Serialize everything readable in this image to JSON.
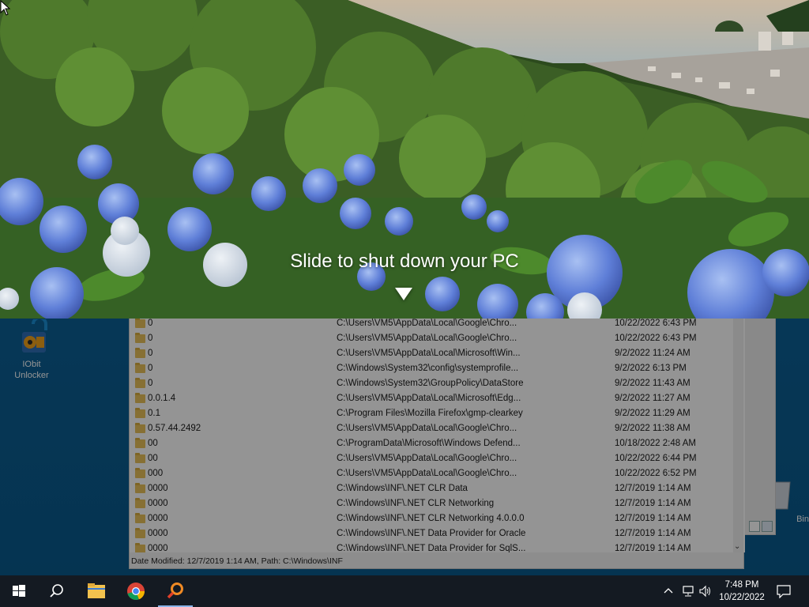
{
  "desktop": {
    "icons": [
      {
        "label_line1": "IObit",
        "label_line2": "Unlocker"
      },
      {
        "label": "Bin"
      }
    ]
  },
  "shutdown": {
    "message": "Slide to shut down your PC"
  },
  "results": {
    "rows": [
      {
        "name": "0",
        "path": "C:\\Users\\VM5\\AppData\\Local\\Google\\Chro...",
        "date": "10/22/2022 6:43 PM"
      },
      {
        "name": "0",
        "path": "C:\\Users\\VM5\\AppData\\Local\\Google\\Chro...",
        "date": "10/22/2022 6:43 PM"
      },
      {
        "name": "0",
        "path": "C:\\Users\\VM5\\AppData\\Local\\Microsoft\\Win...",
        "date": "9/2/2022 11:24 AM"
      },
      {
        "name": "0",
        "path": "C:\\Windows\\System32\\config\\systemprofile...",
        "date": "9/2/2022 6:13 PM"
      },
      {
        "name": "0",
        "path": "C:\\Windows\\System32\\GroupPolicy\\DataStore",
        "date": "9/2/2022 11:43 AM"
      },
      {
        "name": "0.0.1.4",
        "path": "C:\\Users\\VM5\\AppData\\Local\\Microsoft\\Edg...",
        "date": "9/2/2022 11:27 AM"
      },
      {
        "name": "0.1",
        "path": "C:\\Program Files\\Mozilla Firefox\\gmp-clearkey",
        "date": "9/2/2022 11:29 AM"
      },
      {
        "name": "0.57.44.2492",
        "path": "C:\\Users\\VM5\\AppData\\Local\\Google\\Chro...",
        "date": "9/2/2022 11:38 AM"
      },
      {
        "name": "00",
        "path": "C:\\ProgramData\\Microsoft\\Windows Defend...",
        "date": "10/18/2022 2:48 AM"
      },
      {
        "name": "00",
        "path": "C:\\Users\\VM5\\AppData\\Local\\Google\\Chro...",
        "date": "10/22/2022 6:44 PM"
      },
      {
        "name": "000",
        "path": "C:\\Users\\VM5\\AppData\\Local\\Google\\Chro...",
        "date": "10/22/2022 6:52 PM"
      },
      {
        "name": "0000",
        "path": "C:\\Windows\\INF\\.NET CLR Data",
        "date": "12/7/2019 1:14 AM"
      },
      {
        "name": "0000",
        "path": "C:\\Windows\\INF\\.NET CLR Networking",
        "date": "12/7/2019 1:14 AM"
      },
      {
        "name": "0000",
        "path": "C:\\Windows\\INF\\.NET CLR Networking 4.0.0.0",
        "date": "12/7/2019 1:14 AM"
      },
      {
        "name": "0000",
        "path": "C:\\Windows\\INF\\.NET Data Provider for Oracle",
        "date": "12/7/2019 1:14 AM"
      },
      {
        "name": "0000",
        "path": "C:\\Windows\\INF\\.NET Data Provider for SqlS...",
        "date": "12/7/2019 1:14 AM"
      }
    ],
    "status": "Date Modified: 12/7/2019 1:14 AM, Path: C:\\Windows\\INF"
  },
  "taskbar": {
    "buttons": [
      "start-icon",
      "search-icon",
      "file-explorer-icon",
      "chrome-icon",
      "search-everything-icon"
    ],
    "clock_time": "7:48 PM",
    "clock_date": "10/22/2022"
  },
  "colors": {
    "desktop": "#0b5f94",
    "taskbar": "#141a22",
    "folder": "#e8c25a"
  }
}
